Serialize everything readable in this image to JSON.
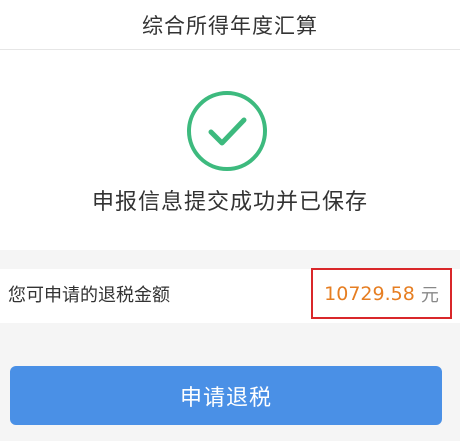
{
  "header": {
    "title": "综合所得年度汇算"
  },
  "status": {
    "icon": "check-circle-icon",
    "message": "申报信息提交成功并已保存",
    "icon_color": "#3dba7e"
  },
  "refund": {
    "label": "您可申请的退税金额",
    "amount": "10729.58",
    "unit": "元",
    "amount_color": "#e67e22",
    "highlight_color": "#d9272a"
  },
  "actions": {
    "apply_refund_label": "申请退税",
    "button_color": "#4a90e6"
  }
}
